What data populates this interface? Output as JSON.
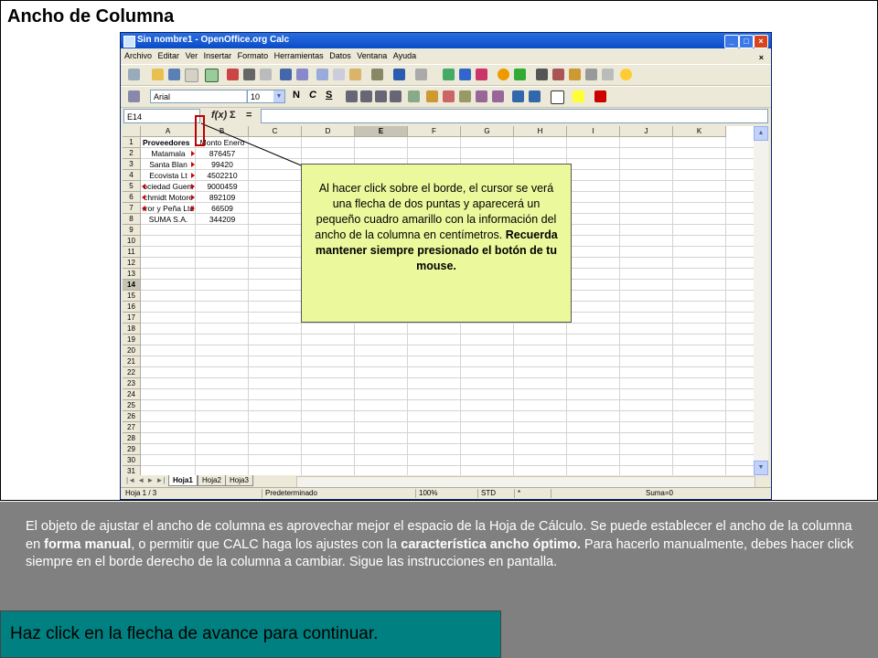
{
  "slide": {
    "title": "Ancho de Columna",
    "callout": {
      "text_plain": "Al hacer click sobre el borde, el cursor se verá una flecha de dos puntas y aparecerá un pequeño cuadro amarillo con la información del ancho de la columna en centímetros.",
      "text_bold": "Recuerda mantener siempre presionado el botón de tu mouse."
    },
    "instructions": {
      "p1": "El objeto de ajustar el ancho de columna es aprovechar mejor el espacio de la Hoja de Cálculo. Se puede establecer el ancho de la columna en",
      "b1": "forma manual",
      "p2": ", o permitir que CALC haga los ajustes con la",
      "b2": "característica ancho óptimo.",
      "p3": " Para hacerlo manualmente, debes hacer click siempre en el borde derecho de la columna a cambiar. Sigue las instrucciones en pantalla."
    },
    "footer": "Haz click en la flecha de avance para continuar."
  },
  "window": {
    "title": "Sin nombre1 - OpenOffice.org Calc",
    "controls": {
      "minimize": "_",
      "maximize": "□",
      "close": "×"
    },
    "menu": [
      "Archivo",
      "Editar",
      "Ver",
      "Insertar",
      "Formato",
      "Herramientas",
      "Datos",
      "Ventana",
      "Ayuda"
    ],
    "menu_close": "×",
    "font_name": "Arial",
    "font_size": "10",
    "format_buttons": [
      "N",
      "C",
      "S"
    ],
    "name_box": "E14",
    "fx_label": "f(x)",
    "sum_label": "Σ",
    "eq_label": "="
  },
  "sheet": {
    "columns": [
      "A",
      "B",
      "C",
      "D",
      "E",
      "F",
      "G",
      "H",
      "I",
      "J",
      "K"
    ],
    "selected_column": "E",
    "selected_row": "14",
    "rows": [
      "1",
      "2",
      "3",
      "4",
      "5",
      "6",
      "7",
      "8",
      "9",
      "10",
      "11",
      "12",
      "13",
      "14",
      "15",
      "16",
      "17",
      "18",
      "19",
      "20",
      "21",
      "22",
      "23",
      "24",
      "25",
      "26",
      "27",
      "28",
      "29",
      "30",
      "31"
    ],
    "data": [
      {
        "a": "Proveedores",
        "b": "Monto Enero"
      },
      {
        "a": "Matamala",
        "b": "876457"
      },
      {
        "a": "Santa Blan",
        "b": "99420"
      },
      {
        "a": "Ecovista Lt",
        "b": "4502210"
      },
      {
        "a": "ociedad Guem",
        "b": "9000459"
      },
      {
        "a": "chmidt Motore",
        "b": "892109"
      },
      {
        "a": "rror y Peña Ltd",
        "b": "66509"
      },
      {
        "a": "SUMA S.A.",
        "b": "344209"
      }
    ],
    "tabs": [
      "Hoja1",
      "Hoja2",
      "Hoja3"
    ]
  },
  "status": {
    "sheet": "Hoja 1 / 3",
    "style": "Predeterminado",
    "zoom": "100%",
    "mode": "STD",
    "star": "*",
    "sum": "Suma=0"
  },
  "colors": {
    "callout_bg": "#ecf89c",
    "bottom_bg": "#808080",
    "footer_bg": "#008080",
    "highlight_box": "#c00000"
  }
}
